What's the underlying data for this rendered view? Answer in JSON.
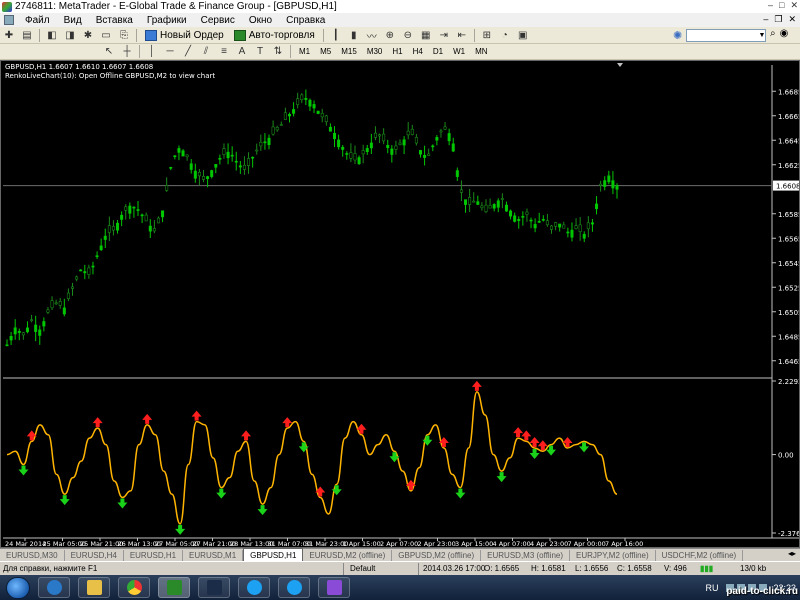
{
  "window": {
    "title": "2746811: MetaTrader - E-Global Trade & Finance Group - [GBPUSD,H1]",
    "controls": [
      "–",
      "□",
      "✕"
    ]
  },
  "menu": {
    "items": [
      "Файл",
      "Вид",
      "Вставка",
      "Графики",
      "Сервис",
      "Окно",
      "Справка"
    ],
    "mdi_controls": [
      "–",
      "❐",
      "✕"
    ]
  },
  "toolbar": {
    "new_order_label": "Новый Ордер",
    "auto_trading_label": "Авто-торговля",
    "timeframes": [
      "M1",
      "M5",
      "M15",
      "M30",
      "H1",
      "H4",
      "D1",
      "W1",
      "MN"
    ],
    "search_value": ""
  },
  "chart": {
    "ohlc_text": "GBPUSD,H1  1.6607 1.6610 1.6607 1.6608",
    "renko_text": "RenkoLiveChart(10): Open Offline GBPUSD,M2 to view chart",
    "price_labels": [
      "1.6685",
      "1.6665",
      "1.6645",
      "1.6625",
      "1.6608",
      "1.6585",
      "1.6565",
      "1.6545",
      "1.6525",
      "1.6505",
      "1.6485",
      "1.6465"
    ],
    "current_price": "1.6608",
    "indicator_labels": [
      "2.2293",
      "0.00",
      "-2.3767"
    ],
    "time_labels": [
      "24 Mar 2014",
      "25 Mar 05:00",
      "25 Mar 21:00",
      "26 Mar 13:00",
      "27 Mar 05:00",
      "27 Mar 21:00",
      "28 Mar 13:00",
      "31 Mar 07:00",
      "31 Mar 23:00",
      "1 Apr 15:00",
      "2 Apr 07:00",
      "2 Apr 23:00",
      "3 Apr 15:00",
      "4 Apr 07:00",
      "4 Apr 23:00",
      "7 Apr 00:00",
      "7 Apr 16:00"
    ],
    "colors": {
      "bull": "#00c800",
      "bear": "#1a8a1a",
      "indicator_line": "#ffb400",
      "up_arrow": "#ff1e1e",
      "down_arrow": "#19d219"
    }
  },
  "chart_data": {
    "type": "line",
    "price": [
      1.6478,
      1.6492,
      1.6486,
      1.6498,
      1.649,
      1.6505,
      1.6512,
      1.6508,
      1.6525,
      1.654,
      1.6535,
      1.6552,
      1.6568,
      1.6572,
      1.6585,
      1.6592,
      1.6588,
      1.6578,
      1.657,
      1.659,
      1.6628,
      1.664,
      1.663,
      1.6618,
      1.6612,
      1.6622,
      1.6632,
      1.6636,
      1.6626,
      1.662,
      1.6634,
      1.6642,
      1.6648,
      1.6655,
      1.6664,
      1.6672,
      1.668,
      1.6677,
      1.6666,
      1.6658,
      1.6648,
      1.6636,
      1.6628,
      1.6632,
      1.6641,
      1.665,
      1.6642,
      1.6636,
      1.6644,
      1.6652,
      1.6638,
      1.663,
      1.6646,
      1.6655,
      1.6648,
      1.6604,
      1.6592,
      1.6596,
      1.6586,
      1.6592,
      1.6598,
      1.6588,
      1.658,
      1.6585,
      1.6576,
      1.6581,
      1.6572,
      1.6577,
      1.657,
      1.6573,
      1.6568,
      1.6577,
      1.6608,
      1.6616,
      1.6608
    ],
    "indicator": [
      0.0,
      0.1,
      -0.3,
      0.4,
      0.9,
      0.6,
      -0.6,
      -1.2,
      -0.7,
      -0.2,
      0.5,
      0.8,
      0.3,
      -0.8,
      -1.3,
      -1.1,
      0.3,
      0.9,
      0.6,
      -0.5,
      -1.2,
      -2.1,
      -0.3,
      1.0,
      0.9,
      -0.1,
      -1.0,
      -0.7,
      0.1,
      0.4,
      -0.8,
      -1.5,
      -1.0,
      0.0,
      0.8,
      1.0,
      0.4,
      -0.6,
      -1.3,
      -1.8,
      -0.9,
      0.5,
      1.0,
      0.6,
      0.0,
      0.3,
      0.6,
      0.1,
      -0.5,
      -1.1,
      -0.4,
      0.6,
      0.9,
      0.2,
      -0.6,
      -1.0,
      0.2,
      1.9,
      1.2,
      0.0,
      -0.5,
      -0.1,
      0.5,
      0.4,
      0.2,
      0.1,
      0.3,
      0.5,
      0.2,
      0.3,
      0.4,
      0.3,
      0.0,
      -0.8,
      -1.2
    ],
    "up_arrows": [
      3,
      11,
      17,
      23,
      29,
      34,
      38,
      43,
      49,
      53,
      57,
      62,
      63,
      64,
      65,
      68
    ],
    "down_arrows": [
      2,
      7,
      14,
      21,
      26,
      31,
      36,
      40,
      47,
      51,
      55,
      60,
      64,
      66,
      70
    ],
    "ylim_price": [
      1.6455,
      1.6695
    ],
    "ylim_indicator": [
      -2.3767,
      2.2293
    ],
    "grid": false
  },
  "tabs": [
    "EURUSD,M30",
    "EURUSD,H4",
    "EURUSD,H1",
    "EURUSD,M1",
    "GBPUSD,H1",
    "EURUSD,M2 (offline)",
    "GBPUSD,M2 (offline)",
    "EURUSD,M3 (offline)",
    "EURJPY,M2 (offline)",
    "USDCHF,M2 (offline)"
  ],
  "active_tab": "GBPUSD,H1",
  "status": {
    "help": "Для справки, нажмите F1",
    "profile": "Default",
    "datetime": "2014.03.26 17:00",
    "open": "O: 1.6565",
    "high": "H: 1.6581",
    "low": "L: 1.6556",
    "close": "C: 1.6558",
    "volume": "V: 496",
    "traffic": "13/0 kb"
  },
  "taskbar": {
    "lang": "RU",
    "time": "23:23",
    "watermark": "paid-to-click.ru"
  }
}
